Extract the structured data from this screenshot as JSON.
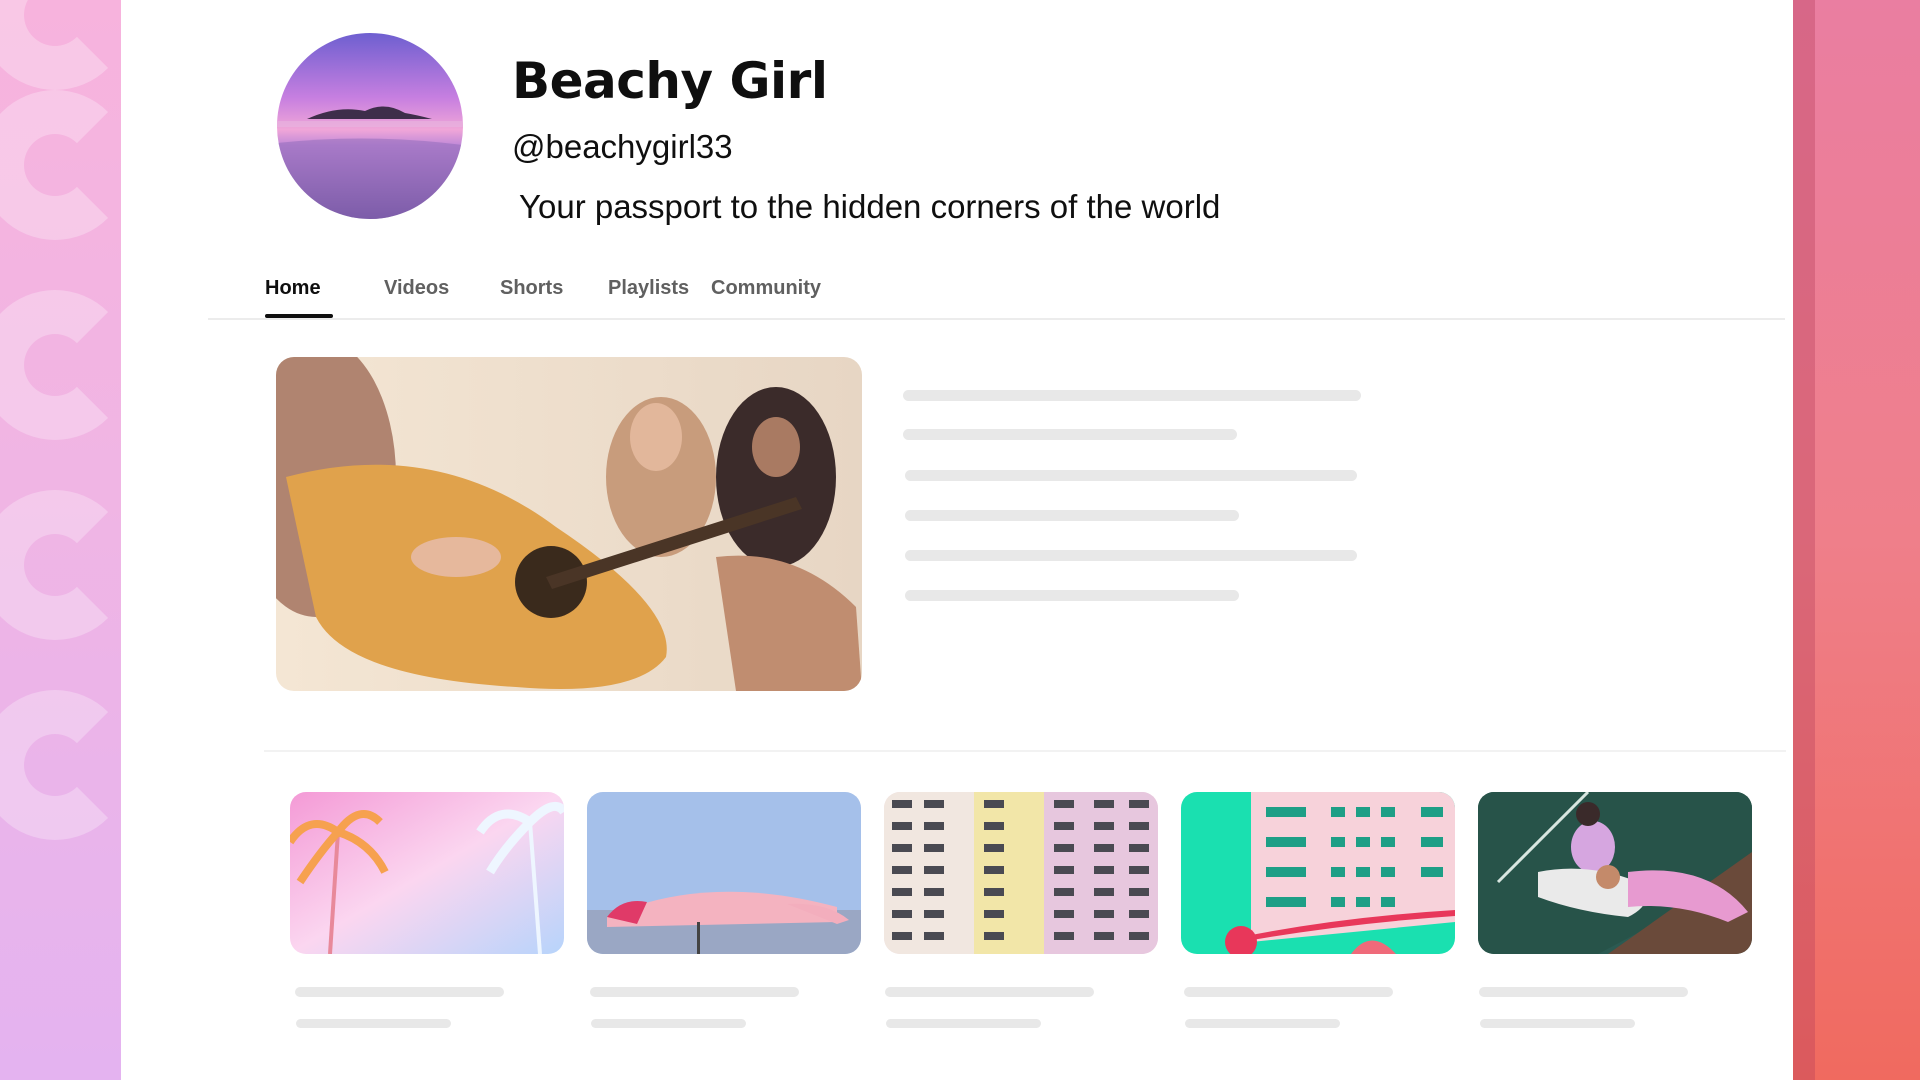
{
  "channel": {
    "name": "Beachy Girl",
    "handle": "@beachygirl33",
    "description": "Your passport to the hidden corners of the world"
  },
  "tabs": [
    {
      "label": "Home",
      "active": true
    },
    {
      "label": "Videos",
      "active": false
    },
    {
      "label": "Shorts",
      "active": false
    },
    {
      "label": "Playlists",
      "active": false
    },
    {
      "label": "Community",
      "active": false
    }
  ],
  "featured_video": {
    "thumbnail": "friends-playing-guitar-on-beach"
  },
  "video_grid": [
    {
      "thumbnail": "pastel-palm-trees"
    },
    {
      "thumbnail": "pink-beach-umbrellas"
    },
    {
      "thumbnail": "pastel-apartment-tower"
    },
    {
      "thumbnail": "pink-building-teal-sky"
    },
    {
      "thumbnail": "women-relaxing-on-court"
    }
  ],
  "colors": {
    "accent": "#0f0f0f",
    "inactive_tab": "#606060",
    "skeleton": "#e8e8e8",
    "bg_left": "#f0b5e4",
    "bg_right": "#ef7f8a"
  }
}
